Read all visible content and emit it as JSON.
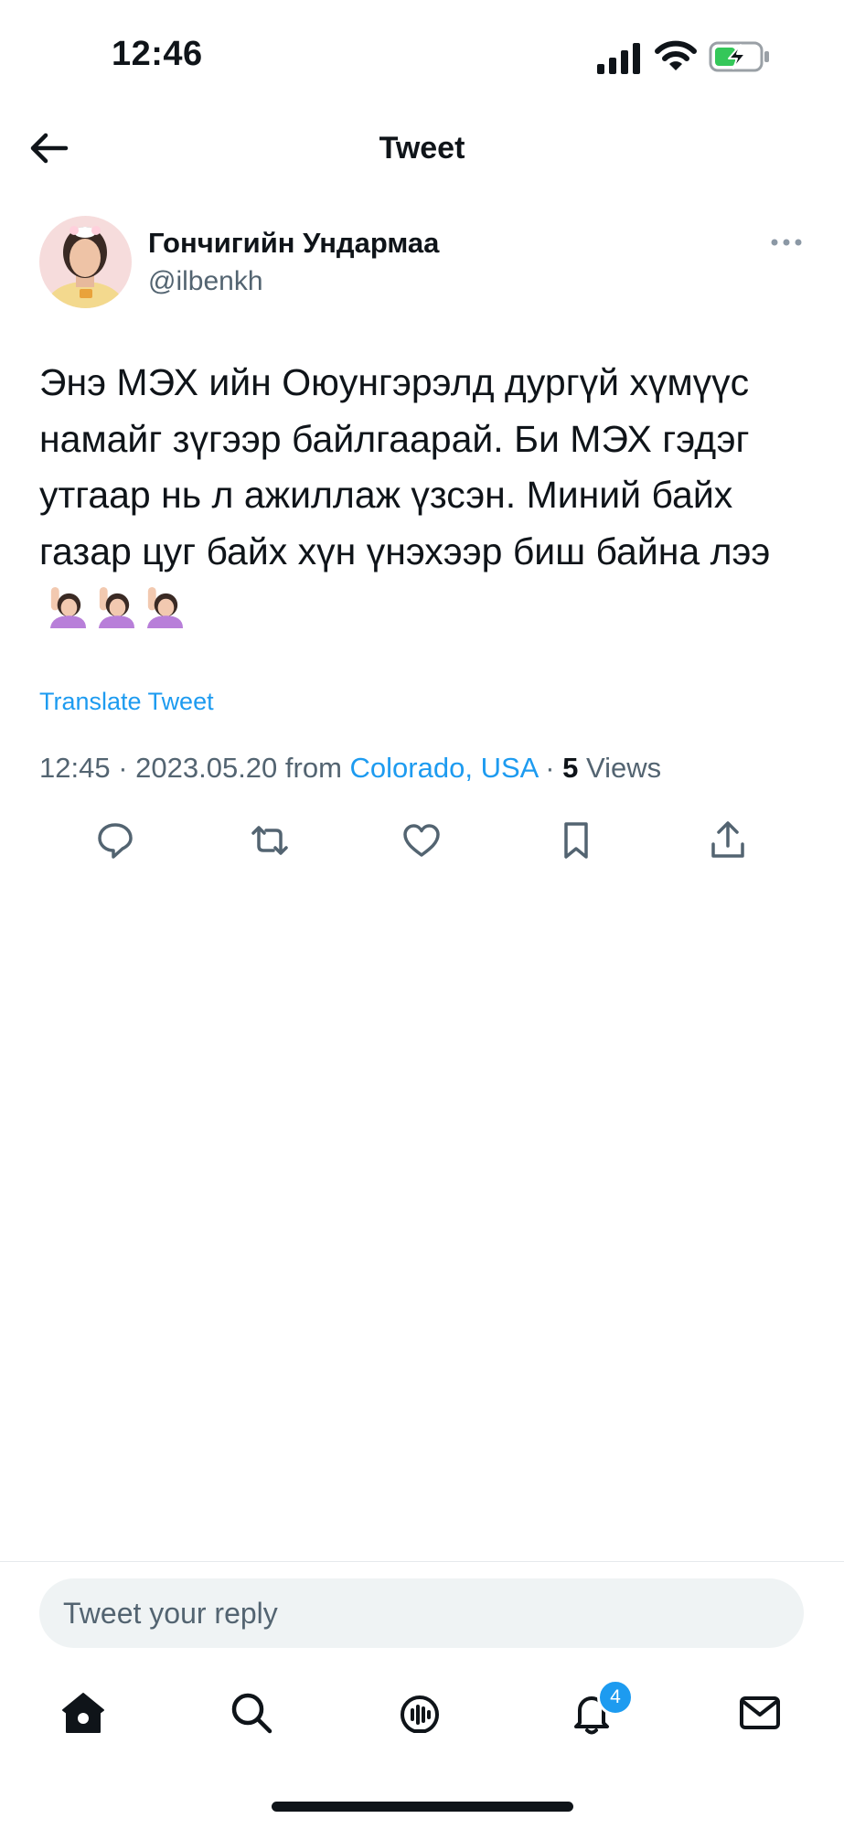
{
  "status_bar": {
    "time": "12:46"
  },
  "header": {
    "title": "Tweet"
  },
  "tweet": {
    "author_name": "Гончигийн Ундармаа",
    "author_handle": "@ilbenkh",
    "text": "Энэ МЭХ ийн Оюунгэрэлд дургүй хүмүүс намайг зүгээр байлгаарай. Би МЭХ гэдэг утгаар нь л ажиллаж үзсэн. Миний байх газар цуг байх хүн үнэхээр биш байна лээ",
    "emoji": "🙋🏻‍♀️🙋🏻‍♀️🙋🏻‍♀️",
    "translate_label": "Translate Tweet",
    "time": "12:45",
    "date": "2023.05.20",
    "from_label": "from",
    "location": "Colorado, USA",
    "views_count": "5",
    "views_label": "Views"
  },
  "reply": {
    "placeholder": "Tweet your reply"
  },
  "bottom_nav": {
    "items": [
      "home",
      "search",
      "spaces",
      "notifications",
      "messages"
    ],
    "notification_badge": "4"
  },
  "icons": {
    "back": "arrow-left-icon",
    "more": "more-horizontal-icon",
    "reply": "comment-icon",
    "retweet": "retweet-icon",
    "like": "heart-icon",
    "bookmark": "bookmark-icon",
    "share": "share-icon"
  },
  "colors": {
    "accent": "#1d9bf0",
    "text": "#0f1419",
    "muted": "#536471",
    "battery_charge": "#34c759"
  }
}
